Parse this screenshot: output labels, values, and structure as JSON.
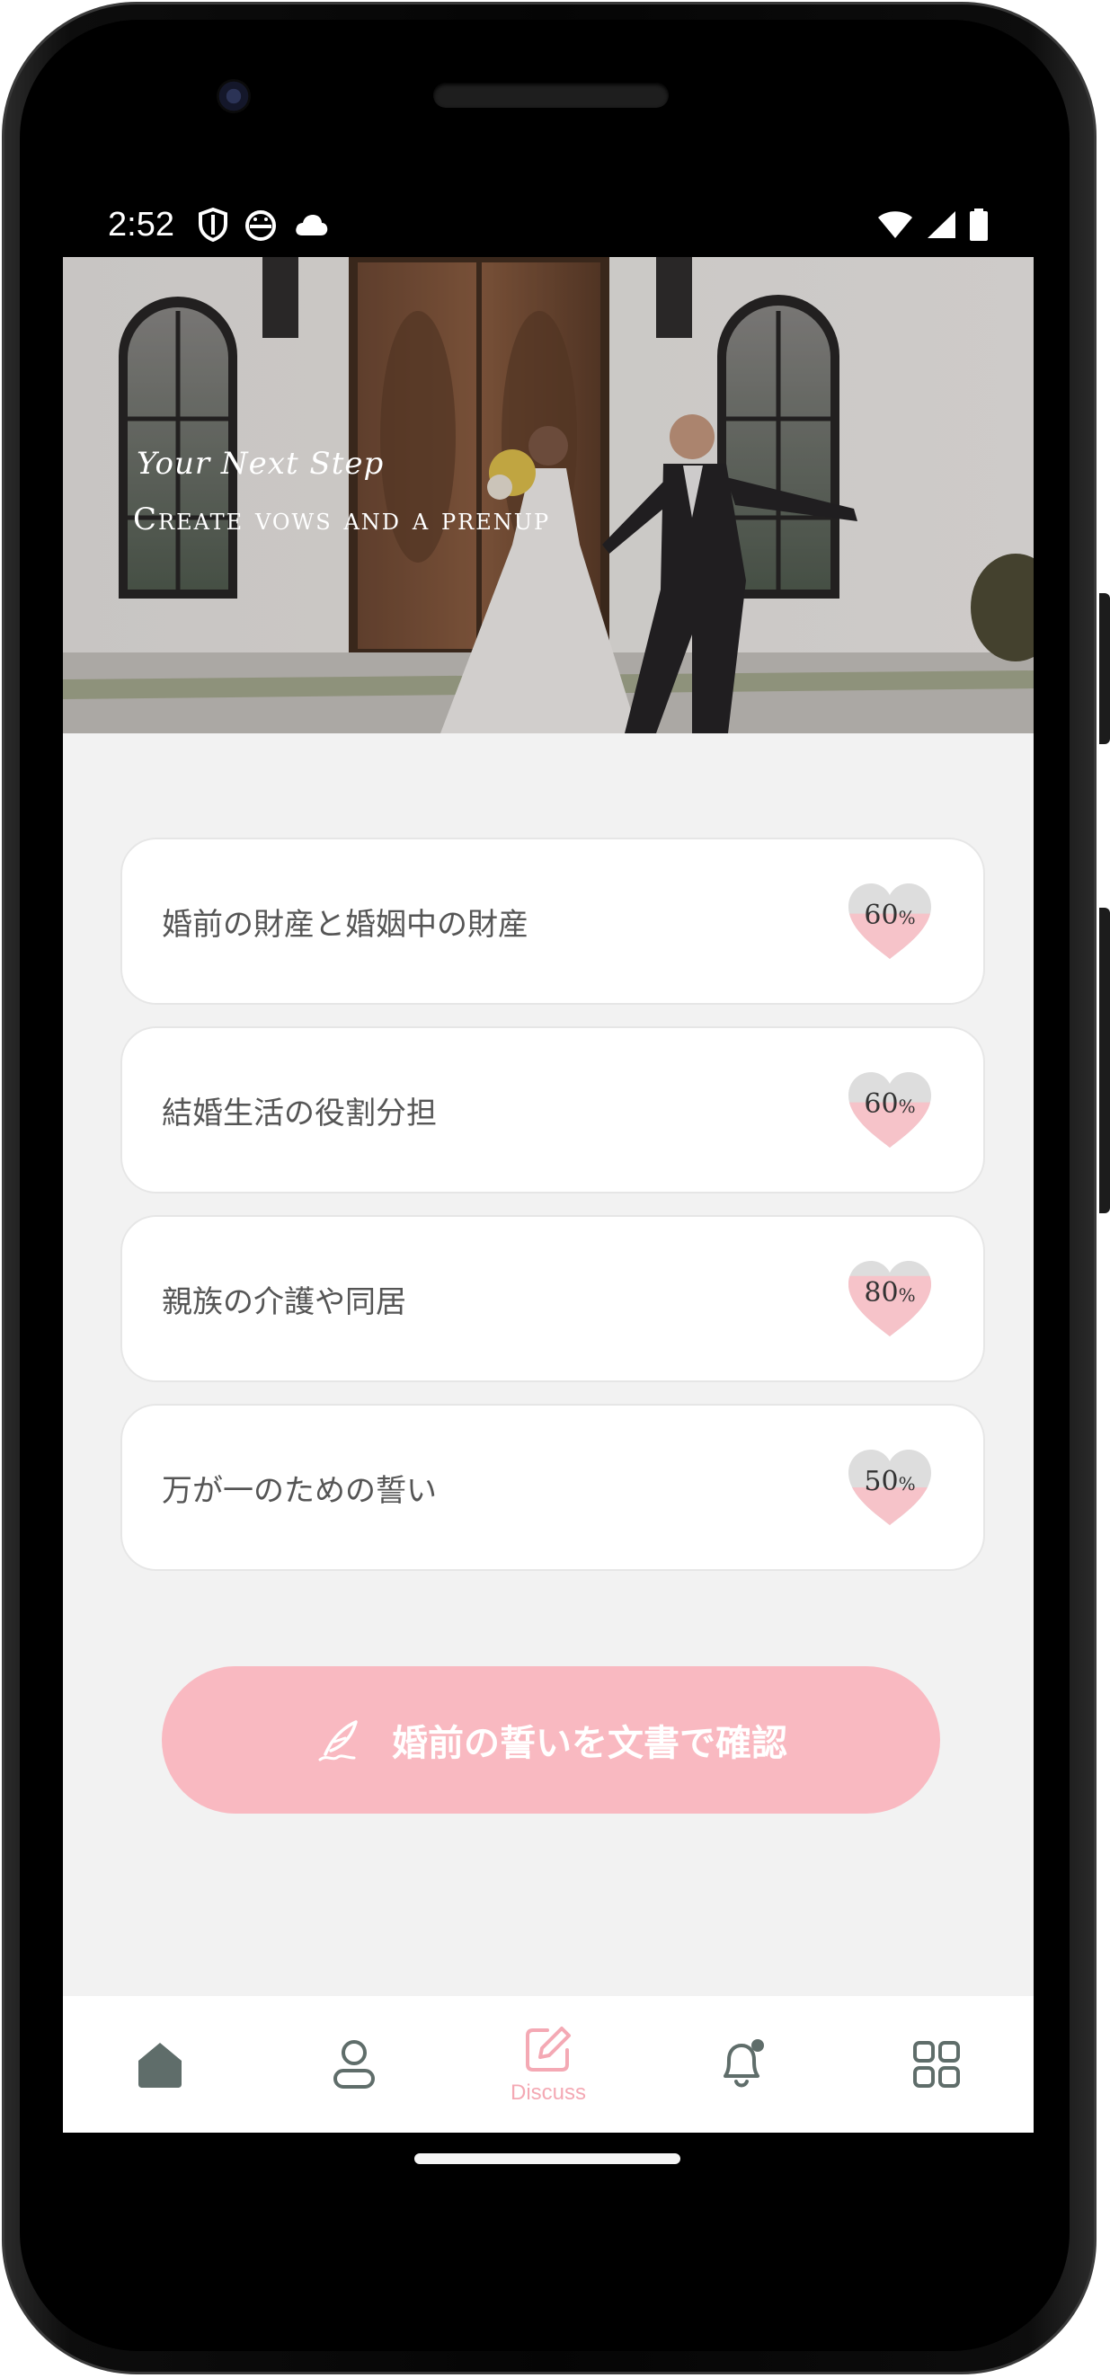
{
  "status_bar": {
    "time": "2:52",
    "left_icons": [
      "shield-icon",
      "android-face-icon",
      "cloud-icon"
    ],
    "right_icons": [
      "wifi-icon",
      "signal-icon",
      "battery-icon"
    ]
  },
  "hero": {
    "eyebrow": "Your Next Step",
    "title": "Create vows and a prenup"
  },
  "items": [
    {
      "label": "婚前の財産と婚姻中の財産",
      "percent": 60,
      "percent_text": "60",
      "unit": "%"
    },
    {
      "label": "結婚生活の役割分担",
      "percent": 60,
      "percent_text": "60",
      "unit": "%"
    },
    {
      "label": "親族の介護や同居",
      "percent": 80,
      "percent_text": "80",
      "unit": "%"
    },
    {
      "label": "万が一のための誓い",
      "percent": 50,
      "percent_text": "50",
      "unit": "%"
    }
  ],
  "cta": {
    "label": "婚前の誓いを文書で確認",
    "icon": "quill-pen-icon"
  },
  "bottom_nav": {
    "items": [
      {
        "icon": "home-icon",
        "label": "",
        "active": false
      },
      {
        "icon": "profile-icon",
        "label": "",
        "active": false
      },
      {
        "icon": "edit-icon",
        "label": "Discuss",
        "active": true
      },
      {
        "icon": "bell-icon",
        "label": "",
        "active": false
      },
      {
        "icon": "grid-icon",
        "label": "",
        "active": false
      }
    ]
  },
  "colors": {
    "accent_pink": "#f9b9c1",
    "heart_fill": "#f6c3c9",
    "heart_empty": "#dddddd",
    "nav_icon": "#5f6d6a",
    "screen_bg": "#f2f2f2"
  }
}
